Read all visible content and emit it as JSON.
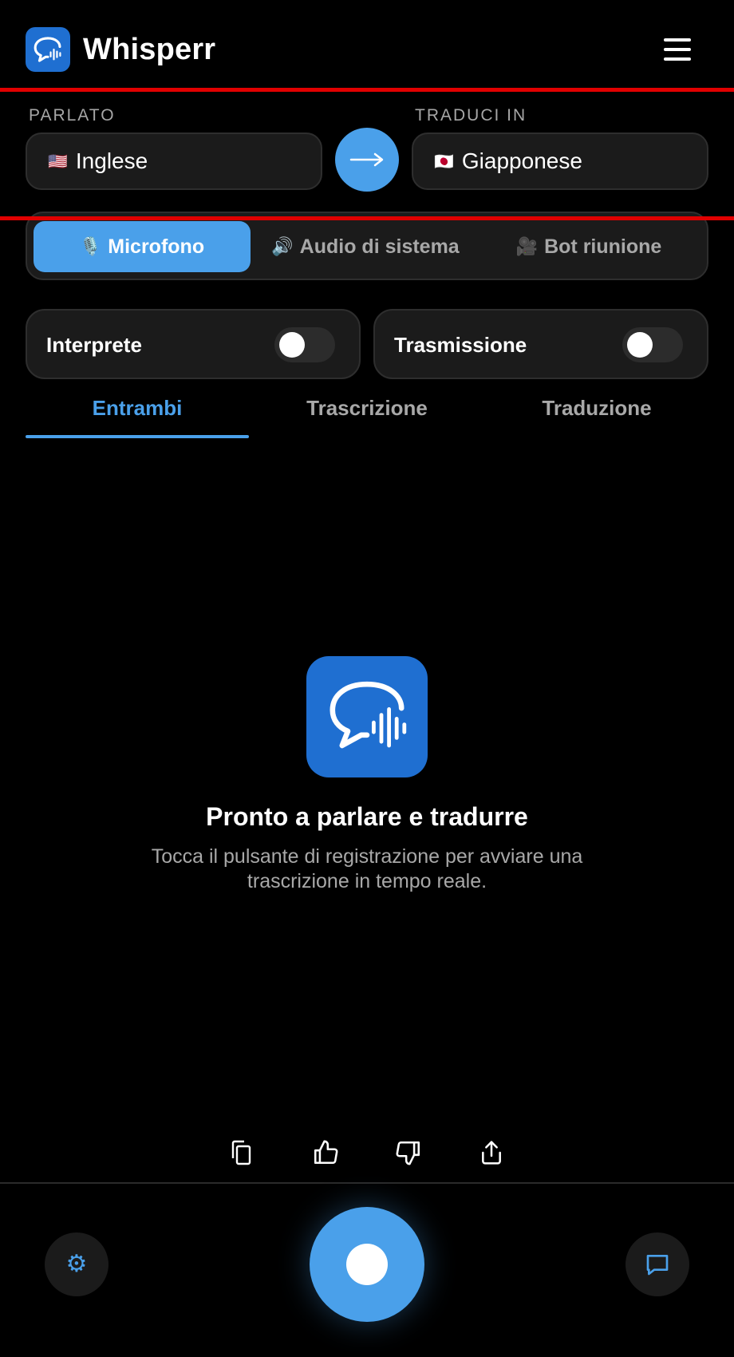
{
  "header": {
    "title": "Whisperr"
  },
  "languages": {
    "source_label": "PARLATO",
    "source_flag": "🇺🇸",
    "source_value": "Inglese",
    "target_label": "TRADUCI IN",
    "target_flag": "🇯🇵",
    "target_value": "Giapponese",
    "swap_symbol": "⟶"
  },
  "source_tabs": [
    {
      "emoji": "🎙️",
      "label": "Microfono",
      "active": true
    },
    {
      "emoji": "🔊",
      "label": "Audio di sistema",
      "active": false
    },
    {
      "emoji": "🎥",
      "label": "Bot riunione",
      "active": false
    }
  ],
  "toggles": {
    "interpreter": {
      "label": "Interprete",
      "on": false
    },
    "broadcast": {
      "label": "Trasmissione",
      "on": false
    }
  },
  "view_tabs": [
    {
      "label": "Entrambi",
      "active": true
    },
    {
      "label": "Trascrizione",
      "active": false
    },
    {
      "label": "Traduzione",
      "active": false
    }
  ],
  "empty_state": {
    "title": "Pronto a parlare e tradurre",
    "description": "Tocca il pulsante di registrazione per avviare una trascrizione in tempo reale."
  },
  "actions": [
    "copy-icon",
    "thumbs-up-icon",
    "thumbs-down-icon",
    "share-icon"
  ],
  "bottom_bar": {
    "settings_glyph": "⚙"
  },
  "colors": {
    "accent": "#4aa0ea",
    "brand": "#1f6fd1",
    "surface": "#1b1b1b",
    "marker": "#e10000"
  }
}
